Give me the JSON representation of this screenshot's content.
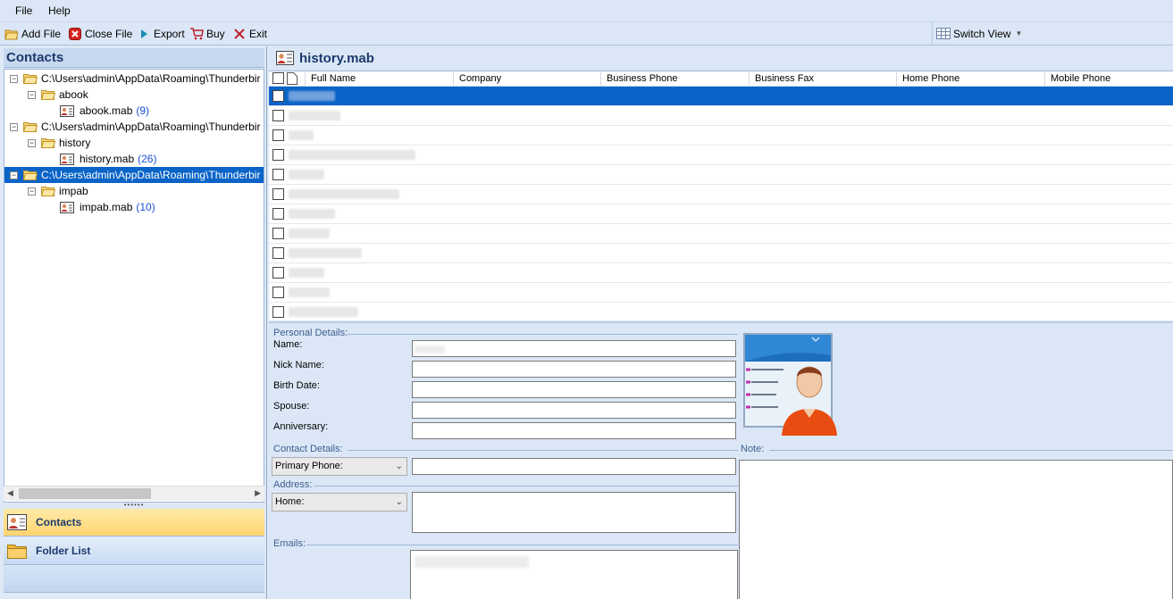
{
  "menu": {
    "file": "File",
    "help": "Help"
  },
  "toolbar": {
    "add_file": "Add File",
    "close_file": "Close File",
    "export": "Export",
    "buy": "Buy",
    "exit": "Exit",
    "switch_view": "Switch View"
  },
  "left": {
    "title": "Contacts",
    "tree": [
      {
        "path": "C:\\Users\\admin\\AppData\\Roaming\\Thunderbir",
        "folder": "abook",
        "file": "abook.mab",
        "count": "(9)"
      },
      {
        "path": "C:\\Users\\admin\\AppData\\Roaming\\Thunderbir",
        "folder": "history",
        "file": "history.mab",
        "count": "(26)"
      },
      {
        "path": "C:\\Users\\admin\\AppData\\Roaming\\Thunderbir",
        "folder": "impab",
        "file": "impab.mab",
        "count": "(10)"
      }
    ],
    "nav": {
      "contacts": "Contacts",
      "folder_list": "Folder List"
    }
  },
  "right": {
    "title": "history.mab",
    "columns": [
      "Full Name",
      "Company",
      "Business Phone",
      "Business Fax",
      "Home Phone",
      "Mobile Phone"
    ],
    "row_count": 12,
    "selected_row": 1
  },
  "details": {
    "personal_label": "Personal Details:",
    "name_label": "Name:",
    "nick_label": "Nick Name:",
    "birth_label": "Birth Date:",
    "spouse_label": "Spouse:",
    "anniv_label": "Anniversary:",
    "contact_label": "Contact Details:",
    "note_label": "Note:",
    "phone_select": "Primary Phone:",
    "address_label": "Address:",
    "address_select": "Home:",
    "emails_label": "Emails:"
  },
  "colors": {
    "selection": "#0a64c8",
    "count": "#1a4ed8",
    "header_text": "#1c3a6e"
  }
}
